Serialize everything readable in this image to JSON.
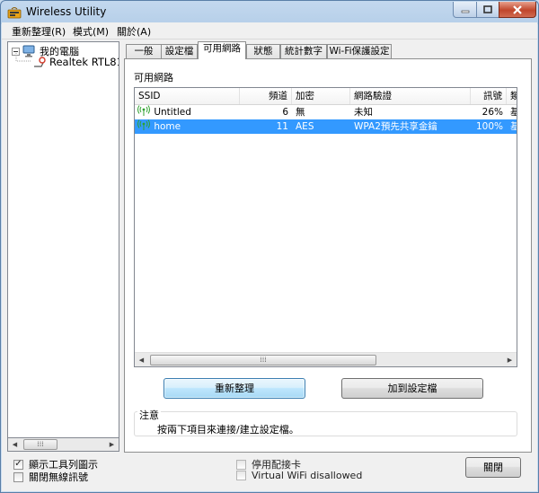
{
  "window": {
    "title": "Wireless Utility"
  },
  "menu": {
    "items": [
      "重新整理(R)",
      "模式(M)",
      "關於(A)"
    ]
  },
  "tree": {
    "root": "我的電腦",
    "child": "Realtek RTL81"
  },
  "tabs": [
    "一般",
    "設定檔",
    "可用網路",
    "狀態",
    "統計數字",
    "Wi-Fi保護設定"
  ],
  "active_tab": "可用網路",
  "available": {
    "section_label": "可用網路",
    "columns": [
      "SSID",
      "頻道",
      "加密",
      "網路驗證",
      "訊號",
      "類"
    ],
    "rows": [
      {
        "ssid": "Untitled",
        "channel": "6",
        "encryption": "無",
        "auth": "未知",
        "signal": "26%",
        "extra": "基",
        "selected": false
      },
      {
        "ssid": "home",
        "channel": "11",
        "encryption": "AES",
        "auth": "WPA2預先共享金鑰",
        "signal": "100%",
        "extra": "基",
        "selected": true
      }
    ]
  },
  "buttons": {
    "refresh": "重新整理",
    "add_profile": "加到設定檔",
    "close": "關閉"
  },
  "note": {
    "title": "注意",
    "text": "按兩下項目來連接/建立設定檔。"
  },
  "options": {
    "show_tray_icon": {
      "label": "顯示工具列圖示",
      "checked": true
    },
    "disable_wireless": {
      "label": "關閉無線訊號",
      "checked": false
    },
    "disable_adapter": {
      "label": "停用配接卡",
      "checked": false
    },
    "virtual_wifi": {
      "label": "Virtual WiFi disallowed",
      "checked": false
    }
  }
}
